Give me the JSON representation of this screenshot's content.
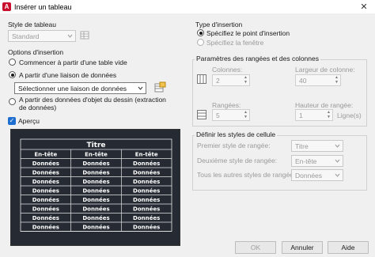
{
  "window": {
    "title": "Insérer un tableau",
    "app_icon_letter": "A"
  },
  "table_style": {
    "label": "Style de tableau",
    "value": "Standard"
  },
  "insert_options": {
    "label": "Options d'insertion",
    "opt_empty": "Commencer à partir d'une table vide",
    "opt_link": "A partir d'une liaison de données",
    "link_select": "Sélectionner une liaison de données",
    "opt_objects": "A partir des données d'objet du dessin (extraction de données)"
  },
  "preview": {
    "checkbox_label": "Aperçu",
    "title": "Titre",
    "headers": [
      "En-tête",
      "En-tête",
      "En-tête"
    ],
    "rows": [
      [
        "Données",
        "Données",
        "Données"
      ],
      [
        "Données",
        "Données",
        "Données"
      ],
      [
        "Données",
        "Données",
        "Données"
      ],
      [
        "Données",
        "Données",
        "Données"
      ],
      [
        "Données",
        "Données",
        "Données"
      ],
      [
        "Données",
        "Données",
        "Données"
      ],
      [
        "Données",
        "Données",
        "Données"
      ],
      [
        "Données",
        "Données",
        "Données"
      ]
    ]
  },
  "insertion_type": {
    "label": "Type d'insertion",
    "opt_point": "Spécifiez le point d'insertion",
    "opt_window": "Spécifiez la fenêtre"
  },
  "rows_cols": {
    "label": "Paramètres des rangées et des colonnes",
    "columns_label": "Colonnes:",
    "columns_value": "2",
    "col_width_label": "Largeur de colonne:",
    "col_width_value": "40",
    "rows_label": "Rangées:",
    "rows_value": "5",
    "row_height_label": "Hauteur de rangée:",
    "row_height_value": "1",
    "row_height_unit": "Ligne(s)"
  },
  "cell_styles": {
    "label": "Définir les styles de cellule",
    "first_row_label": "Premier style de rangée:",
    "first_row_value": "Titre",
    "second_row_label": "Deuxième style de rangée:",
    "second_row_value": "En-tête",
    "other_rows_label": "Tous les autres styles de rangée:",
    "other_rows_value": "Données"
  },
  "buttons": {
    "ok": "OK",
    "cancel": "Annuler",
    "help": "Aide"
  },
  "colors": {
    "accent": "#1f6fd1",
    "preview_bg": "#252a33",
    "preview_line": "#e6e6e6"
  }
}
